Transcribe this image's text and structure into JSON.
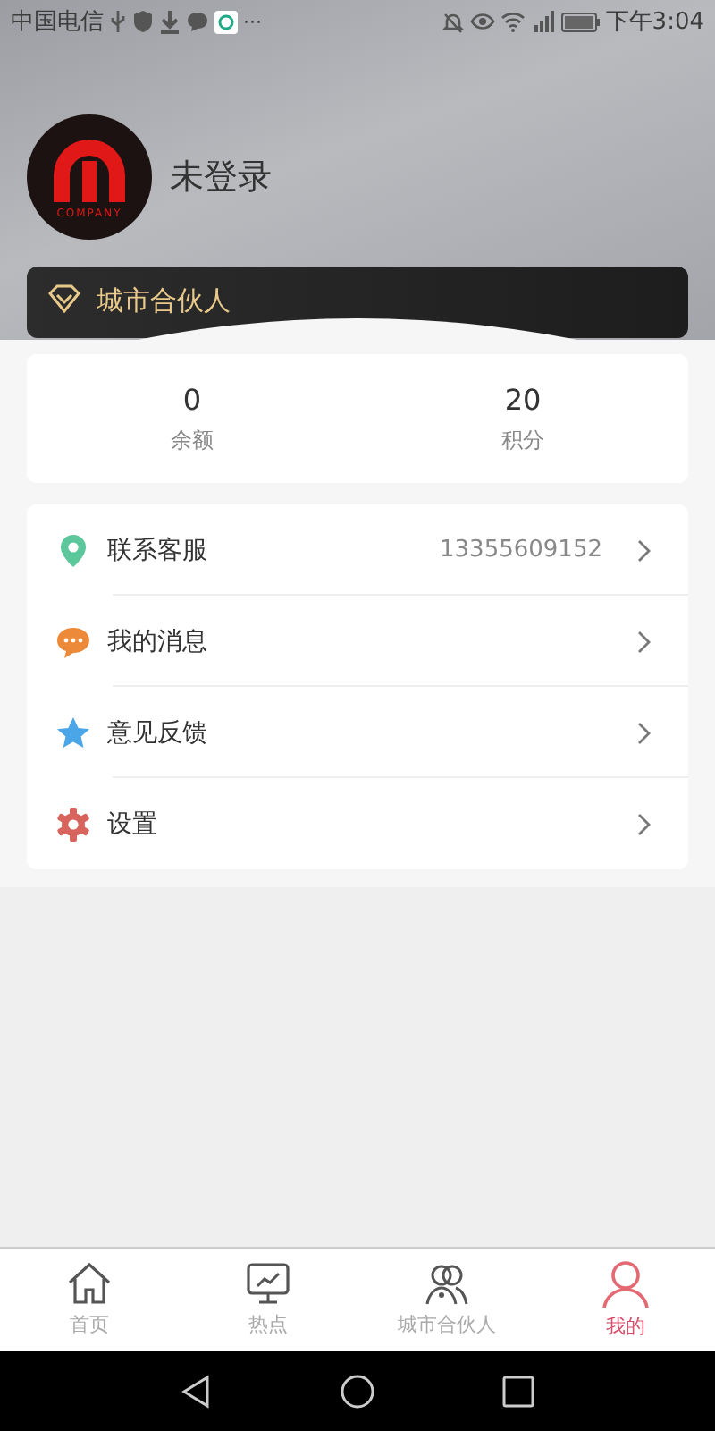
{
  "status_bar": {
    "carrier": "中国电信",
    "more": "···",
    "time": "下午3:04"
  },
  "profile": {
    "logo_text": "COMPANY",
    "name": "未登录"
  },
  "partner_card": {
    "label": "城市合伙人"
  },
  "stats": [
    {
      "value": "0",
      "label": "余额"
    },
    {
      "value": "20",
      "label": "积分"
    }
  ],
  "menu": [
    {
      "kind": "location",
      "label": "联系客服",
      "value": "13355609152"
    },
    {
      "kind": "message",
      "label": "我的消息"
    },
    {
      "kind": "star",
      "label": "意见反馈"
    },
    {
      "kind": "settings",
      "label": "设置"
    }
  ],
  "tabs": [
    {
      "kind": "home",
      "label": "首页",
      "selected": false
    },
    {
      "kind": "chart",
      "label": "热点",
      "selected": false
    },
    {
      "kind": "people",
      "label": "城市合伙人",
      "selected": false
    },
    {
      "kind": "person",
      "label": "我的",
      "selected": true
    }
  ]
}
